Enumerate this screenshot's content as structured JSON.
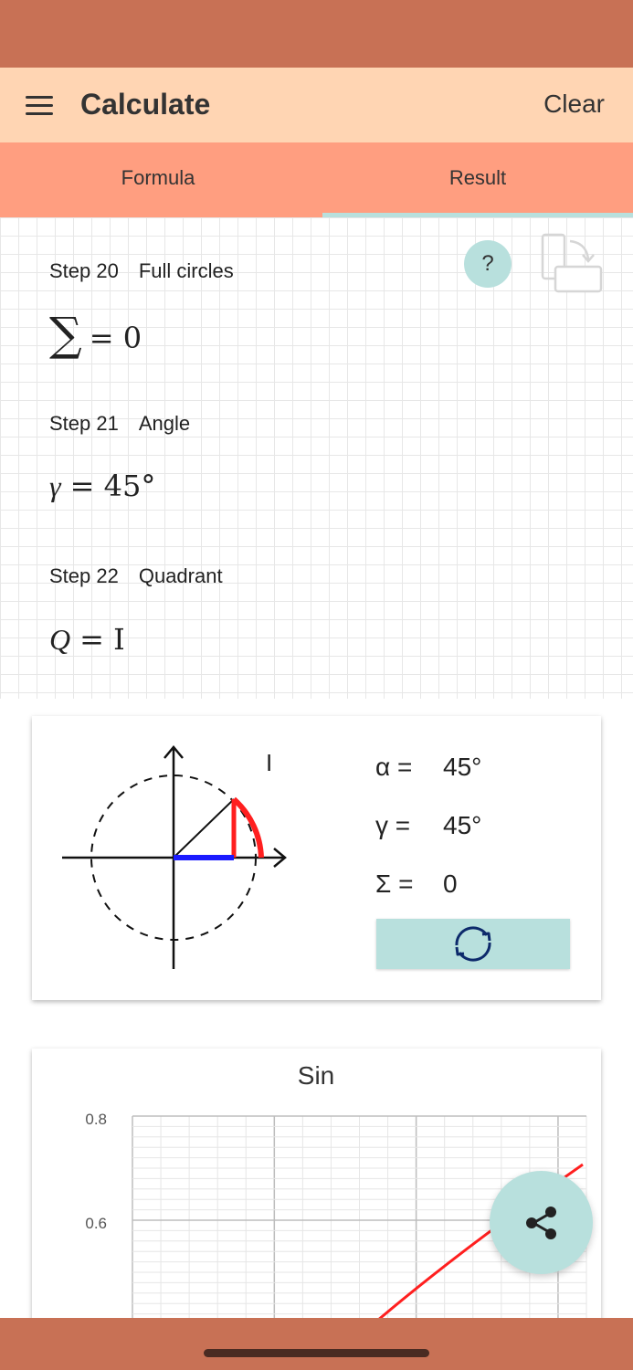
{
  "app_bar": {
    "title": "Calculate",
    "clear_label": "Clear",
    "color": "#ffd5b3"
  },
  "tabs": [
    {
      "label": "Formula"
    },
    {
      "label": "Result",
      "selected": true
    }
  ],
  "help": {
    "label": "?"
  },
  "steps": [
    {
      "label": "Step 20",
      "name": "Full circles",
      "lhs": "∑",
      "rhs": "= 0"
    },
    {
      "label": "Step 21",
      "name": "Angle",
      "lhs": "γ",
      "rhs": "= 45°"
    },
    {
      "label": "Step 22",
      "name": "Quadrant",
      "lhs": "Q",
      "rhs": "= I"
    }
  ],
  "angle_card": {
    "quadrant_label": "I",
    "rows": [
      {
        "label": "α =",
        "value": "45°"
      },
      {
        "label": "γ =",
        "value": "45°"
      },
      {
        "label": "Σ =",
        "value": "0"
      }
    ]
  },
  "chart_data": {
    "type": "line",
    "title": "Sin",
    "y_tick_labels": [
      "0.8",
      "0.6"
    ],
    "ylim": [
      0.45,
      0.82
    ],
    "series": [
      {
        "values_visible": "rising red line",
        "color": "#ff1f1f"
      }
    ]
  },
  "colors": {
    "status_bar": "#c87155",
    "tab_bar": "#ff9e80",
    "accent": "#b8e0dd",
    "arc": "#ff1f1f",
    "projection": "#1a1aff"
  },
  "icons": {
    "menu": "menu-icon",
    "rotate": "rotate-device-icon",
    "refresh": "refresh-icon",
    "share": "share-icon"
  }
}
